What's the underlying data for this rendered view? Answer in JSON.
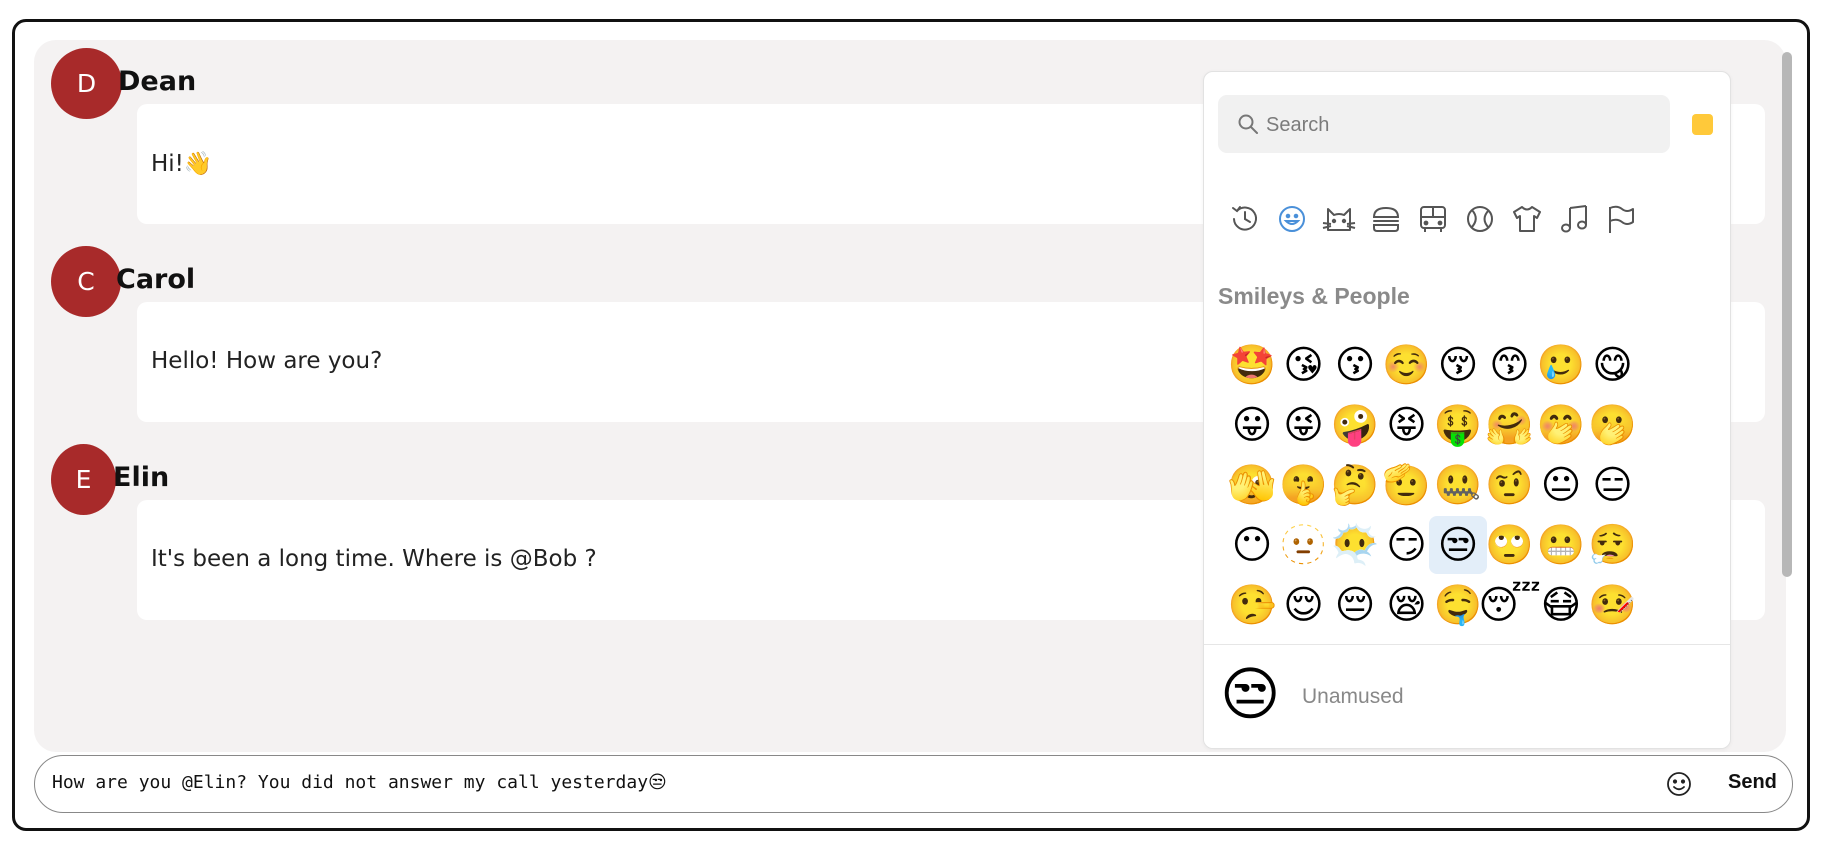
{
  "messages": [
    {
      "initial": "D",
      "author": "Dean",
      "text": "Hi!",
      "emoji": "👋"
    },
    {
      "initial": "C",
      "author": "Carol",
      "text": "Hello! How are you?",
      "emoji": ""
    },
    {
      "initial": "E",
      "author": "Elin",
      "text": "It's been a long time. Where is @Bob ?",
      "emoji": ""
    }
  ],
  "picker": {
    "search_placeholder": "Search",
    "skin_tone_color": "#ffc93a",
    "categories": [
      {
        "name": "recent-icon",
        "active": false
      },
      {
        "name": "smileys-icon",
        "active": true
      },
      {
        "name": "animals-icon",
        "active": false
      },
      {
        "name": "food-icon",
        "active": false
      },
      {
        "name": "travel-icon",
        "active": false
      },
      {
        "name": "activities-icon",
        "active": false
      },
      {
        "name": "objects-icon",
        "active": false
      },
      {
        "name": "symbols-icon",
        "active": false
      },
      {
        "name": "flags-icon",
        "active": false
      }
    ],
    "section_title": "Smileys & People",
    "rows": [
      [
        "🤩",
        "😘",
        "😗",
        "☺️",
        "😚",
        "😙",
        "🥲",
        "😋"
      ],
      [
        "😛",
        "😜",
        "🤪",
        "😝",
        "🤑",
        "🤗",
        "🤭",
        "🫢"
      ],
      [
        "🫣",
        "🤫",
        "🤔",
        "🫡",
        "🤐",
        "🤨",
        "😐",
        "😑"
      ],
      [
        "😶",
        "🫥",
        "😶‍🌫️",
        "😏",
        "😒",
        "🙄",
        "😬",
        "😮‍💨"
      ],
      [
        "🤥",
        "😌",
        "😔",
        "😪",
        "🤤",
        "😴",
        "😷",
        "🤒"
      ]
    ],
    "selected": {
      "row": 3,
      "col": 4
    },
    "preview_emoji": "😒",
    "preview_name": "Unamused"
  },
  "composer": {
    "text": "How are you @Elin? You did not answer my call yesterday",
    "emoji": "😒",
    "send_label": "Send",
    "emoji_button_icon": "smiley-icon"
  },
  "colors": {
    "avatar": "#a82a2a",
    "accent": "#4a90d9",
    "panel_bg": "#f4f2f2"
  }
}
